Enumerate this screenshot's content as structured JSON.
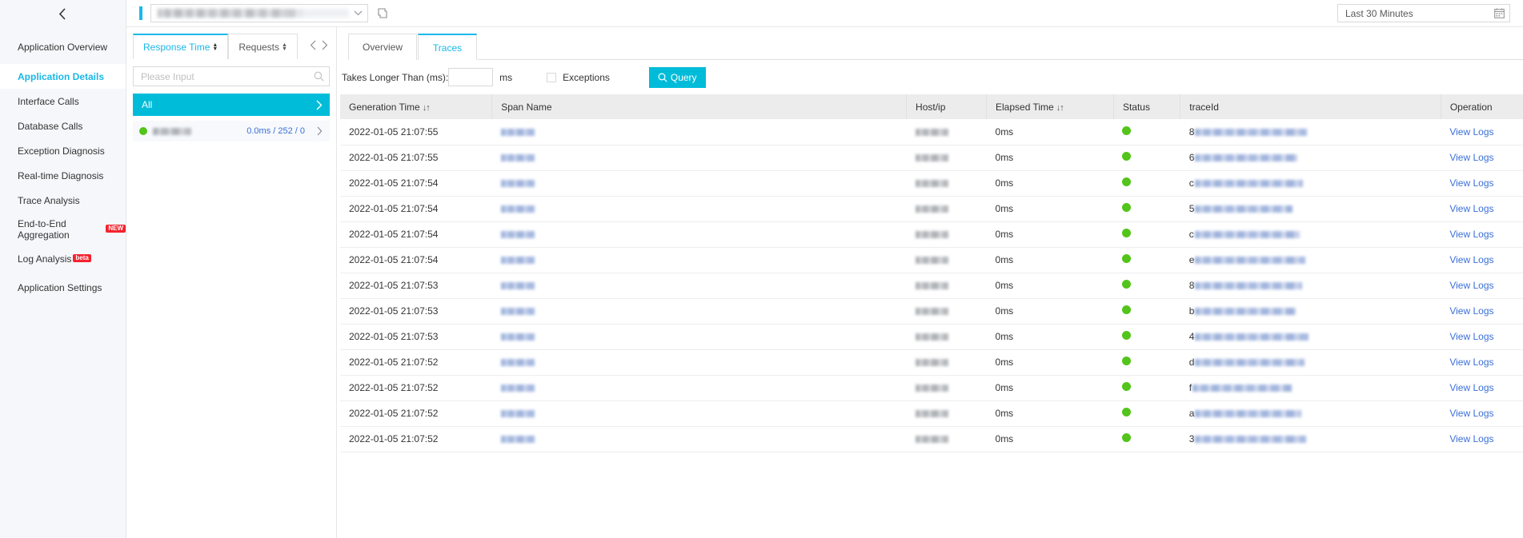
{
  "topbar": {
    "collapse_icon": "chevron-left-icon",
    "app_selector": {
      "value": "",
      "redacted": true,
      "chevron_icon": "chevron-down-icon"
    },
    "copy_icon": "copy-icon",
    "time_range": {
      "value": "Last 30 Minutes",
      "calendar_icon": "calendar-icon"
    }
  },
  "sidebar": {
    "items": [
      {
        "label": "Application Overview",
        "active": false,
        "badge": ""
      },
      {
        "label": "Application Details",
        "active": true,
        "badge": ""
      },
      {
        "label": "Interface Calls",
        "active": false,
        "badge": ""
      },
      {
        "label": "Database Calls",
        "active": false,
        "badge": ""
      },
      {
        "label": "Exception Diagnosis",
        "active": false,
        "badge": ""
      },
      {
        "label": "Real-time Diagnosis",
        "active": false,
        "badge": ""
      },
      {
        "label": "Trace Analysis",
        "active": false,
        "badge": ""
      },
      {
        "label": "End-to-End Aggregation",
        "active": false,
        "badge": "NEW"
      },
      {
        "label": "Log Analysis",
        "active": false,
        "badge": "beta"
      },
      {
        "label": "Application Settings",
        "active": false,
        "badge": ""
      }
    ]
  },
  "midpanel": {
    "tabs": [
      {
        "label": "Response Time",
        "active": true,
        "sort_icon": "sort-updown-icon"
      },
      {
        "label": "Requests",
        "active": false,
        "sort_icon": "sort-updown-icon"
      }
    ],
    "nav": {
      "prev_icon": "chevron-left-icon",
      "next_icon": "chevron-right-icon"
    },
    "search": {
      "placeholder": "Please Input",
      "value": "",
      "icon": "search-icon"
    },
    "all_row": {
      "label": "All",
      "arrow_icon": "chevron-right-icon"
    },
    "service_row": {
      "status_icon": "green-status-dot",
      "name": "",
      "redacted": true,
      "stats": "0.0ms / 252 / 0",
      "arrow_icon": "chevron-right-icon"
    }
  },
  "rightpanel": {
    "tabs": [
      {
        "label": "Overview",
        "active": false
      },
      {
        "label": "Traces",
        "active": true
      }
    ],
    "filters": {
      "takes_longer_label": "Takes Longer Than (ms):",
      "takes_longer_value": "",
      "unit_label": "ms",
      "exceptions_label": "Exceptions",
      "exceptions_checked": false,
      "query_label": "Query",
      "query_icon": "search-icon"
    },
    "table": {
      "columns": [
        {
          "key": "generation_time",
          "label": "Generation Time",
          "sortable": true
        },
        {
          "key": "span_name",
          "label": "Span Name",
          "sortable": false
        },
        {
          "key": "host_ip",
          "label": "Host/ip",
          "sortable": false
        },
        {
          "key": "elapsed_time",
          "label": "Elapsed Time",
          "sortable": true
        },
        {
          "key": "status",
          "label": "Status",
          "sortable": false
        },
        {
          "key": "trace_id",
          "label": "traceId",
          "sortable": false
        },
        {
          "key": "operation",
          "label": "Operation",
          "sortable": false
        }
      ],
      "rows": [
        {
          "generation_time": "2022-01-05 21:07:55",
          "span_name": "",
          "host_ip": "",
          "elapsed_time": "0ms",
          "status": "ok",
          "trace_id_prefix": "8",
          "trace_id_width": 140,
          "operation": "View Logs"
        },
        {
          "generation_time": "2022-01-05 21:07:55",
          "span_name": "",
          "host_ip": "",
          "elapsed_time": "0ms",
          "status": "ok",
          "trace_id_prefix": "6",
          "trace_id_width": 128,
          "operation": "View Logs"
        },
        {
          "generation_time": "2022-01-05 21:07:54",
          "span_name": "",
          "host_ip": "",
          "elapsed_time": "0ms",
          "status": "ok",
          "trace_id_prefix": "c",
          "trace_id_width": 135,
          "operation": "View Logs"
        },
        {
          "generation_time": "2022-01-05 21:07:54",
          "span_name": "",
          "host_ip": "",
          "elapsed_time": "0ms",
          "status": "ok",
          "trace_id_prefix": "5",
          "trace_id_width": 122,
          "operation": "View Logs"
        },
        {
          "generation_time": "2022-01-05 21:07:54",
          "span_name": "",
          "host_ip": "",
          "elapsed_time": "0ms",
          "status": "ok",
          "trace_id_prefix": "c",
          "trace_id_width": 131,
          "operation": "View Logs"
        },
        {
          "generation_time": "2022-01-05 21:07:54",
          "span_name": "",
          "host_ip": "",
          "elapsed_time": "0ms",
          "status": "ok",
          "trace_id_prefix": "e",
          "trace_id_width": 138,
          "operation": "View Logs"
        },
        {
          "generation_time": "2022-01-05 21:07:53",
          "span_name": "",
          "host_ip": "",
          "elapsed_time": "0ms",
          "status": "ok",
          "trace_id_prefix": "8",
          "trace_id_width": 134,
          "operation": "View Logs"
        },
        {
          "generation_time": "2022-01-05 21:07:53",
          "span_name": "",
          "host_ip": "",
          "elapsed_time": "0ms",
          "status": "ok",
          "trace_id_prefix": "b",
          "trace_id_width": 126,
          "operation": "View Logs"
        },
        {
          "generation_time": "2022-01-05 21:07:53",
          "span_name": "",
          "host_ip": "",
          "elapsed_time": "0ms",
          "status": "ok",
          "trace_id_prefix": "4",
          "trace_id_width": 142,
          "operation": "View Logs"
        },
        {
          "generation_time": "2022-01-05 21:07:52",
          "span_name": "",
          "host_ip": "",
          "elapsed_time": "0ms",
          "status": "ok",
          "trace_id_prefix": "d",
          "trace_id_width": 137,
          "operation": "View Logs"
        },
        {
          "generation_time": "2022-01-05 21:07:52",
          "span_name": "",
          "host_ip": "",
          "elapsed_time": "0ms",
          "status": "ok",
          "trace_id_prefix": "f",
          "trace_id_width": 124,
          "operation": "View Logs"
        },
        {
          "generation_time": "2022-01-05 21:07:52",
          "span_name": "",
          "host_ip": "",
          "elapsed_time": "0ms",
          "status": "ok",
          "trace_id_prefix": "a",
          "trace_id_width": 133,
          "operation": "View Logs"
        },
        {
          "generation_time": "2022-01-05 21:07:52",
          "span_name": "",
          "host_ip": "",
          "elapsed_time": "0ms",
          "status": "ok",
          "trace_id_prefix": "3",
          "trace_id_width": 139,
          "operation": "View Logs"
        }
      ]
    }
  },
  "colors": {
    "accent": "#1ab8e8",
    "primary_button": "#00bcd9",
    "link": "#3a6fd8",
    "status_ok": "#52c41a",
    "badge_red": "#f5222d",
    "sidebar_bg": "#f5f7fa",
    "table_header_bg": "#ececec"
  }
}
